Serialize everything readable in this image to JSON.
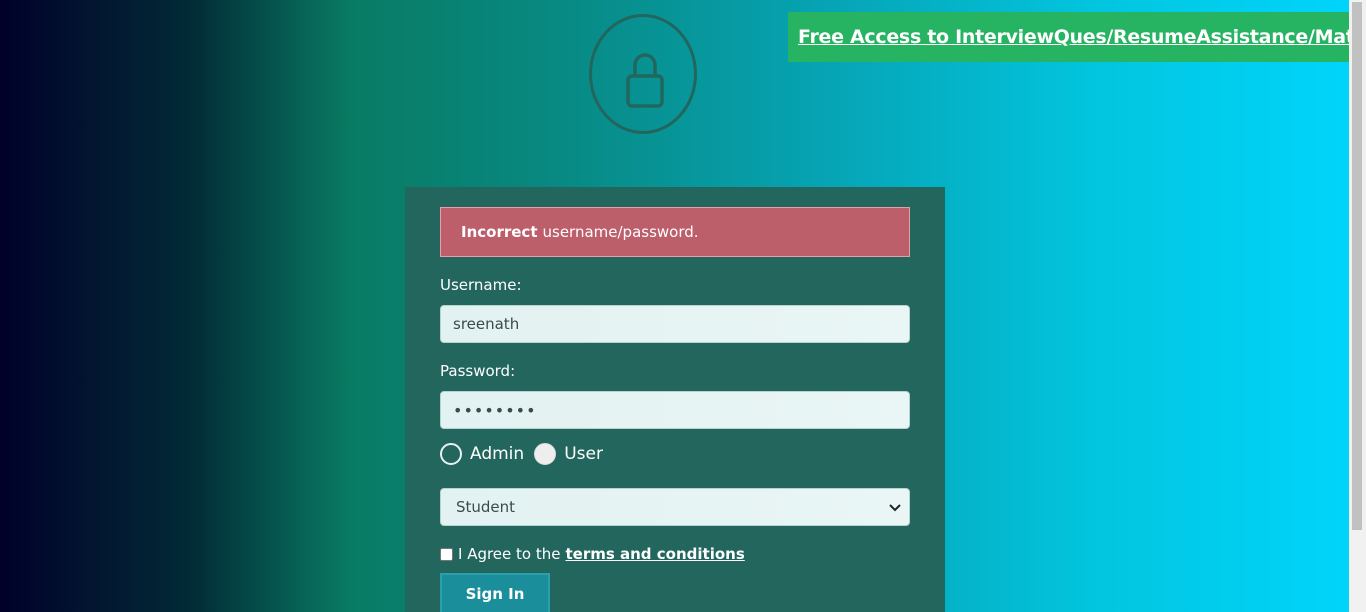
{
  "promo": {
    "link_text": "Free Access to InterviewQues/ResumeAssistance/Material"
  },
  "alert": {
    "strong": "Incorrect",
    "message": "username/password."
  },
  "form": {
    "username_label": "Username:",
    "username_value": "sreenath",
    "password_label": "Password:",
    "password_masked": "••••••••",
    "radio_admin_label": "Admin",
    "radio_user_label": "User",
    "role_selected": "Student",
    "agree_text": "I Agree to the",
    "terms_link": "terms and conditions",
    "signin_label": "Sign In"
  },
  "icons": {
    "lock": "lock-icon",
    "select_chevron": "chevron-down-icon"
  },
  "colors": {
    "card": "#22665e",
    "alert": "#bd5e6b",
    "promo": "#26b362",
    "button": "#1a8e9a"
  }
}
